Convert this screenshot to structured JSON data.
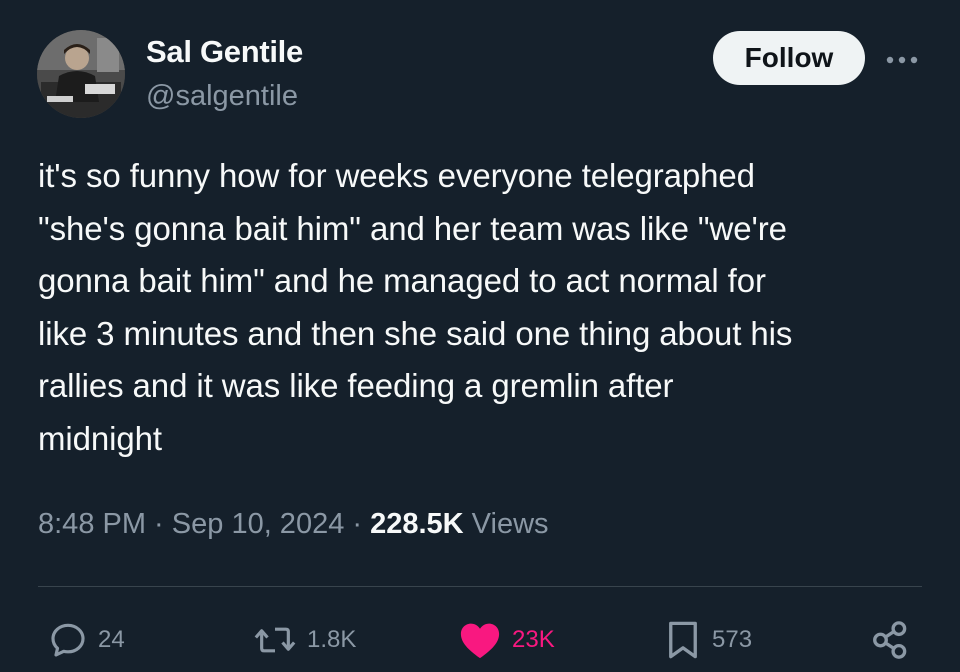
{
  "author": {
    "display_name": "Sal Gentile",
    "handle": "@salgentile"
  },
  "header": {
    "follow_label": "Follow",
    "more_icon": "more-horizontal-icon"
  },
  "tweet": {
    "lines": [
      "it's so funny how for weeks everyone telegraphed",
      "\"she's gonna bait him\" and her team was like \"we're",
      "gonna bait him\" and he managed to act normal for",
      "like 3 minutes and then she said one thing about his",
      "rallies and it was like feeding a gremlin after",
      "midnight"
    ]
  },
  "meta": {
    "time": "8:48 PM",
    "separator": " · ",
    "date": "Sep 10, 2024",
    "views_count": "228.5K",
    "views_label": " Views"
  },
  "actions": {
    "replies": "24",
    "retweets": "1.8K",
    "likes": "23K",
    "bookmarks": "573"
  },
  "colors": {
    "background": "#15202b",
    "text_primary": "#f7f9f9",
    "text_secondary": "#8b98a5",
    "like_pink": "#f91880",
    "follow_button_bg": "#eff3f4"
  }
}
